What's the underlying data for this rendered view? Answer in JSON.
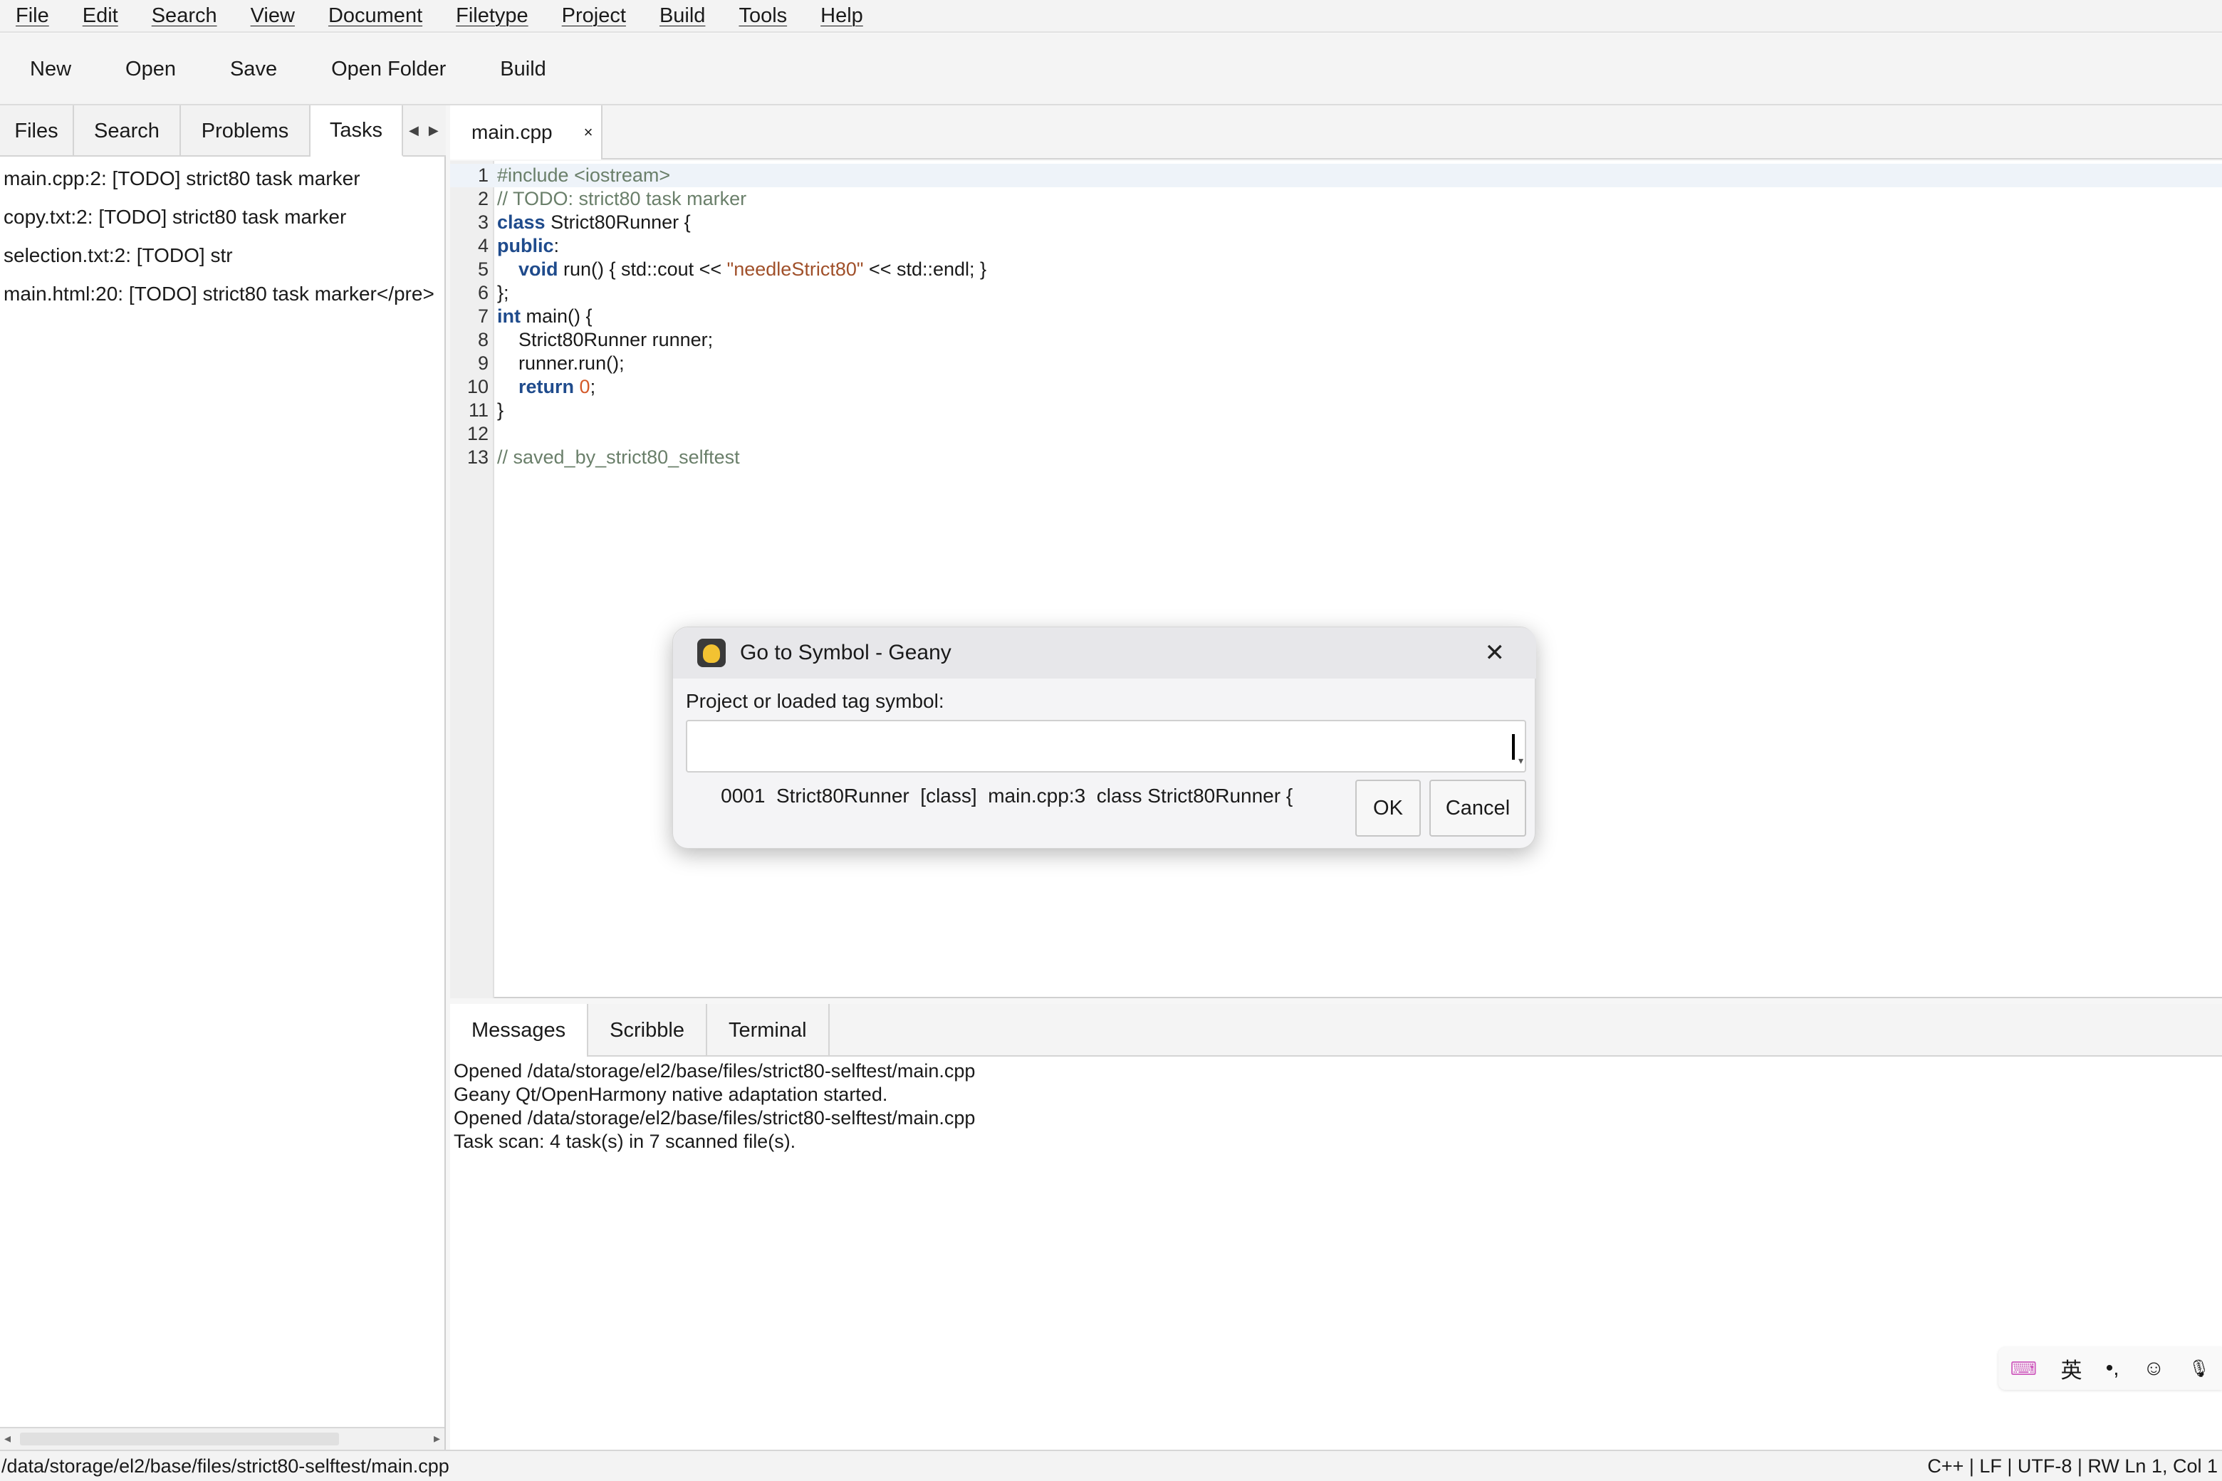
{
  "menu": [
    "File",
    "Edit",
    "Search",
    "View",
    "Document",
    "Filetype",
    "Project",
    "Build",
    "Tools",
    "Help"
  ],
  "toolbar": {
    "new": "New",
    "open": "Open",
    "save": "Save",
    "open_folder": "Open Folder",
    "build": "Build"
  },
  "sidebar": {
    "tabs": [
      "Files",
      "Search",
      "Problems",
      "Tasks"
    ],
    "active_tab": "Tasks",
    "tasks": [
      "main.cpp:2: [TODO] strict80 task marker",
      "copy.txt:2: [TODO] strict80 task marker",
      "selection.txt:2: [TODO] str",
      "main.html:20: [TODO] strict80 task marker</pre>"
    ]
  },
  "editor": {
    "tab_label": "main.cpp",
    "tab_close": "×",
    "lines": [
      {
        "n": "1",
        "parts": [
          [
            "pp",
            "#include <iostream>"
          ]
        ]
      },
      {
        "n": "2",
        "parts": [
          [
            "cm",
            "// TODO: strict80 task marker"
          ]
        ]
      },
      {
        "n": "3",
        "parts": [
          [
            "kw",
            "class"
          ],
          [
            "",
            " Strict80Runner {"
          ]
        ]
      },
      {
        "n": "4",
        "parts": [
          [
            "kw",
            "public"
          ],
          [
            "",
            ":"
          ]
        ]
      },
      {
        "n": "5",
        "parts": [
          [
            "",
            "    "
          ],
          [
            "kw",
            "void"
          ],
          [
            "",
            " run() { std::cout << "
          ],
          [
            "st",
            "\"needleStrict80\""
          ],
          [
            "",
            " << std::endl; }"
          ]
        ]
      },
      {
        "n": "6",
        "parts": [
          [
            "",
            "};"
          ]
        ]
      },
      {
        "n": "7",
        "parts": [
          [
            "kw",
            "int"
          ],
          [
            "",
            " main() {"
          ]
        ]
      },
      {
        "n": "8",
        "parts": [
          [
            "",
            "    Strict80Runner runner;"
          ]
        ]
      },
      {
        "n": "9",
        "parts": [
          [
            "",
            "    runner.run();"
          ]
        ]
      },
      {
        "n": "10",
        "parts": [
          [
            "",
            "    "
          ],
          [
            "kw",
            "return"
          ],
          [
            "",
            " "
          ],
          [
            "nm",
            "0"
          ],
          [
            "",
            ";"
          ]
        ]
      },
      {
        "n": "11",
        "parts": [
          [
            "",
            "}"
          ]
        ]
      },
      {
        "n": "12",
        "parts": []
      },
      {
        "n": "13",
        "parts": [
          [
            "cm",
            "// saved_by_strict80_selftest"
          ]
        ]
      }
    ]
  },
  "bottom": {
    "tabs": [
      "Messages",
      "Scribble",
      "Terminal"
    ],
    "active_tab": "Messages",
    "messages": [
      "Opened /data/storage/el2/base/files/strict80-selftest/main.cpp",
      "Geany Qt/OpenHarmony native adaptation started.",
      "Opened /data/storage/el2/base/files/strict80-selftest/main.cpp",
      "Task scan: 4 task(s) in 7 scanned file(s)."
    ]
  },
  "ime": {
    "lang": "英",
    "punct": "•,",
    "emoji": "☺",
    "mic": "🎙"
  },
  "status": {
    "path": "/data/storage/el2/base/files/strict80-selftest/main.cpp",
    "info": "C++ | LF | UTF-8 | RW Ln 1, Col 1"
  },
  "dialog": {
    "title": "Go to Symbol - Geany",
    "label": "Project or loaded tag symbol:",
    "value": "0001  Strict80Runner  [class]  main.cpp:3  class Strict80Runner {",
    "ok": "OK",
    "cancel": "Cancel",
    "close": "✕"
  }
}
